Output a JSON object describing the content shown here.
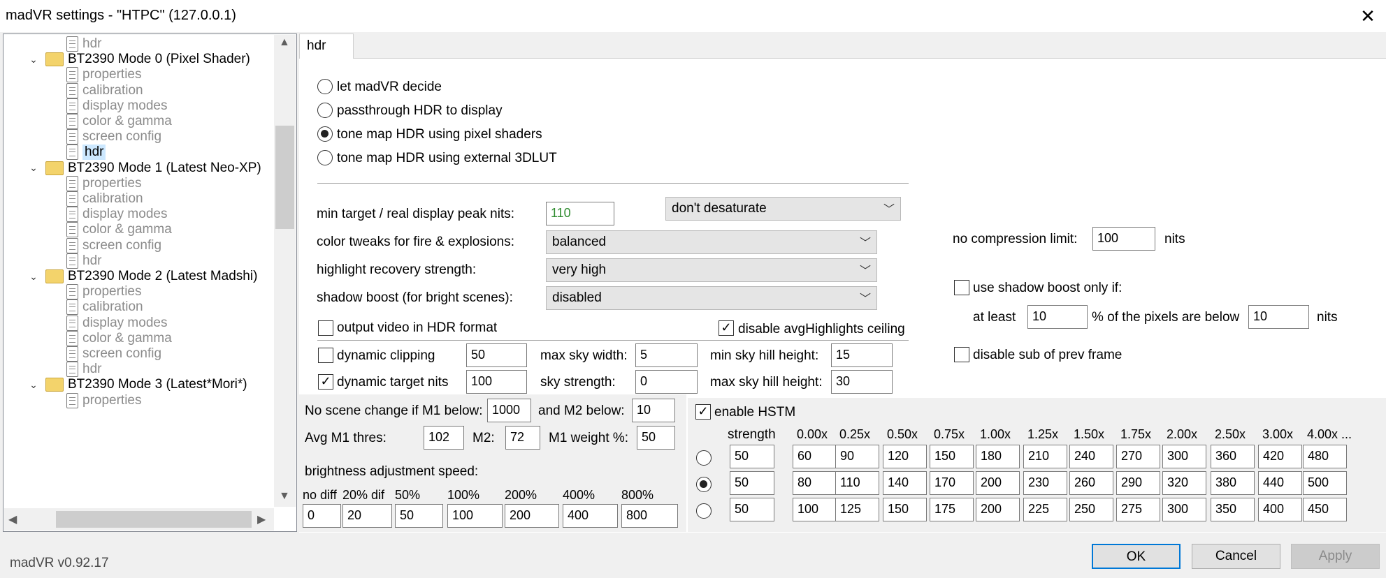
{
  "window": {
    "title": "madVR settings - \"HTPC\" (127.0.0.1)",
    "close_label": "✕"
  },
  "tree": {
    "top_hdr": "hdr",
    "groups": [
      {
        "name": "BT2390 Mode 0 (Pixel Shader)",
        "items": [
          "properties",
          "calibration",
          "display modes",
          "color & gamma",
          "screen config",
          "hdr"
        ]
      },
      {
        "name": "BT2390 Mode 1 (Latest Neo-XP)",
        "items": [
          "properties",
          "calibration",
          "display modes",
          "color & gamma",
          "screen config",
          "hdr"
        ]
      },
      {
        "name": "BT2390 Mode 2 (Latest Madshi)",
        "items": [
          "properties",
          "calibration",
          "display modes",
          "color & gamma",
          "screen config",
          "hdr"
        ]
      },
      {
        "name": "BT2390 Mode 3 (Latest*Mori*)",
        "items": [
          "properties"
        ]
      }
    ],
    "selected": "hdr"
  },
  "tab": {
    "label": "hdr"
  },
  "radios": [
    {
      "label": "let madVR decide",
      "checked": false
    },
    {
      "label": "passthrough HDR to display",
      "checked": false
    },
    {
      "label": "tone map HDR using pixel shaders",
      "checked": true
    },
    {
      "label": "tone map HDR using external 3DLUT",
      "checked": false
    }
  ],
  "form": {
    "min_target_label": "min target / real display peak nits:",
    "min_target_value": "110",
    "desaturate_value": "don't desaturate",
    "color_tweaks_label": "color tweaks for fire & explosions:",
    "color_tweaks_value": "balanced",
    "highlight_label": "highlight recovery strength:",
    "highlight_value": "very high",
    "shadow_label": "shadow boost (for bright scenes):",
    "shadow_value": "disabled",
    "output_hdr_label": "output video in HDR format",
    "disable_avg_label": "disable avgHighlights ceiling",
    "dynamic_clipping_label": "dynamic clipping",
    "dynamic_clipping_value": "50",
    "max_sky_width_label": "max sky width:",
    "max_sky_width_value": "5",
    "min_sky_hill_label": "min sky hill height:",
    "min_sky_hill_value": "15",
    "dynamic_target_label": "dynamic target nits",
    "dynamic_target_value": "100",
    "sky_strength_label": "sky strength:",
    "sky_strength_value": "0",
    "max_sky_hill_label": "max sky hill height:",
    "max_sky_hill_value": "30"
  },
  "right": {
    "no_comp_label": "no compression limit:",
    "no_comp_value": "100",
    "nits": "nits",
    "use_shadow_label": "use shadow boost only if:",
    "at_least_label": "at least",
    "at_least_value": "10",
    "pixels_below_label": "% of the pixels are below",
    "pixels_below_value": "10",
    "disable_sub_label": "disable sub of prev frame"
  },
  "scene": {
    "no_scene_label": "No scene change if M1 below:",
    "m1_below_value": "1000",
    "m2_below_label": "and M2 below:",
    "m2_below_value": "10",
    "avg_m1_label": "Avg M1 thres:",
    "avg_m1_value": "102",
    "m2_label": "M2:",
    "m2_value": "72",
    "m1_weight_label": "M1 weight %:",
    "m1_weight_value": "50",
    "brightness_label": "brightness adjustment speed:",
    "speed_headers": [
      "no diff",
      "20% dif",
      "50%",
      "100%",
      "200%",
      "400%",
      "800%"
    ],
    "speed_values": [
      "0",
      "20",
      "50",
      "100",
      "200",
      "400",
      "800"
    ]
  },
  "hstm": {
    "enable_label": "enable HSTM",
    "strength_label": "strength",
    "headers": [
      "0.00x",
      "0.25x",
      "0.50x",
      "0.75x",
      "1.00x",
      "1.25x",
      "1.50x",
      "1.75x",
      "2.00x",
      "2.50x",
      "3.00x",
      "4.00x ..."
    ],
    "rows": [
      {
        "checked": false,
        "strength": "50",
        "values": [
          "60",
          "90",
          "120",
          "150",
          "180",
          "210",
          "240",
          "270",
          "300",
          "360",
          "420",
          "480"
        ]
      },
      {
        "checked": true,
        "strength": "50",
        "values": [
          "80",
          "110",
          "140",
          "170",
          "200",
          "230",
          "260",
          "290",
          "320",
          "380",
          "440",
          "500"
        ]
      },
      {
        "checked": false,
        "strength": "50",
        "values": [
          "100",
          "125",
          "150",
          "175",
          "200",
          "225",
          "250",
          "275",
          "300",
          "350",
          "400",
          "450"
        ]
      }
    ]
  },
  "footer": {
    "version": "madVR v0.92.17",
    "ok": "OK",
    "cancel": "Cancel",
    "apply": "Apply"
  }
}
